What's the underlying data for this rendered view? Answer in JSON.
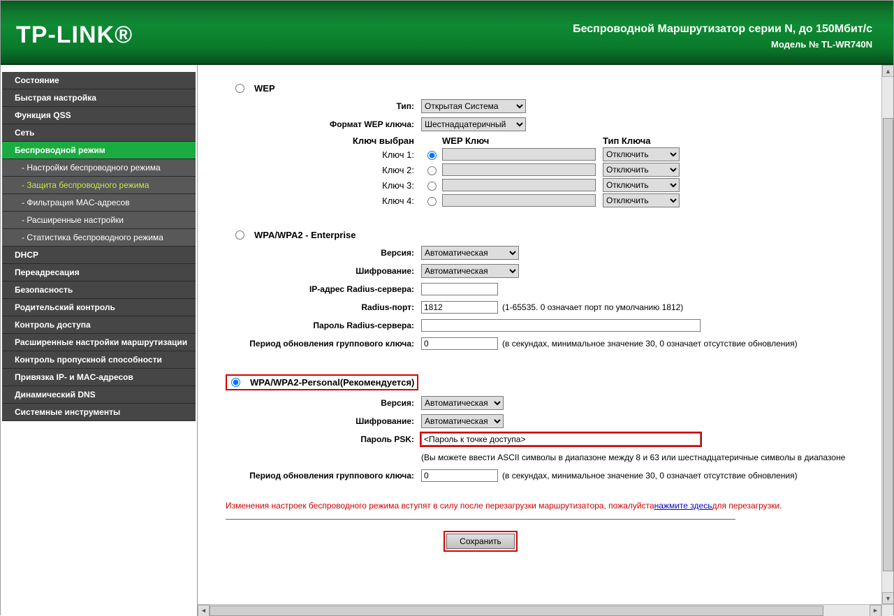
{
  "logo": "TP-LINK®",
  "header": {
    "title": "Беспроводной Маршрутизатор серии N, до 150Мбит/с",
    "model": "Модель № TL-WR740N"
  },
  "sidebar": [
    {
      "label": "Состояние",
      "sub": false
    },
    {
      "label": "Быстрая настройка",
      "sub": false
    },
    {
      "label": "Функция QSS",
      "sub": false
    },
    {
      "label": "Сеть",
      "sub": false
    },
    {
      "label": "Беспроводной режим",
      "sub": false,
      "active": true
    },
    {
      "label": "- Настройки беспроводного режима",
      "sub": true
    },
    {
      "label": "- Защита беспроводного режима",
      "sub": true,
      "current": true
    },
    {
      "label": "- Фильтрация MAC-адресов",
      "sub": true
    },
    {
      "label": "- Расширенные настройки",
      "sub": true
    },
    {
      "label": "- Статистика беспроводного режима",
      "sub": true
    },
    {
      "label": "DHCP",
      "sub": false
    },
    {
      "label": "Переадресация",
      "sub": false
    },
    {
      "label": "Безопасность",
      "sub": false
    },
    {
      "label": "Родительский контроль",
      "sub": false
    },
    {
      "label": "Контроль доступа",
      "sub": false
    },
    {
      "label": "Расширенные настройки маршрутизации",
      "sub": false
    },
    {
      "label": "Контроль пропускной способности",
      "sub": false
    },
    {
      "label": "Привязка IP- и MAC-адресов",
      "sub": false
    },
    {
      "label": "Динамический DNS",
      "sub": false
    },
    {
      "label": "Системные инструменты",
      "sub": false
    }
  ],
  "wep": {
    "title": "WEP",
    "type_label": "Тип:",
    "type_value": "Открытая Система",
    "format_label": "Формат WEP ключа:",
    "format_value": "Шестнадцатеричный",
    "selected_label": "Ключ выбран",
    "wepkey_header": "WEP Ключ",
    "keytype_header": "Тип Ключа",
    "keys": [
      {
        "label": "Ключ 1:",
        "type_value": "Отключить"
      },
      {
        "label": "Ключ 2:",
        "type_value": "Отключить"
      },
      {
        "label": "Ключ 3:",
        "type_value": "Отключить"
      },
      {
        "label": "Ключ 4:",
        "type_value": "Отключить"
      }
    ]
  },
  "ent": {
    "title": "WPA/WPA2 - Enterprise",
    "version_label": "Версия:",
    "version_value": "Автоматическая",
    "enc_label": "Шифрование:",
    "enc_value": "Автоматическая",
    "radius_ip_label": "IP-адрес Radius-сервера:",
    "radius_ip_value": "",
    "radius_port_label": "Radius-порт:",
    "radius_port_value": "1812",
    "radius_port_hint": "(1-65535. 0 означает порт по умолчанию 1812)",
    "radius_pw_label": "Пароль Radius-сервера:",
    "radius_pw_value": "",
    "gk_label": "Период обновления группового ключа:",
    "gk_value": "0",
    "gk_hint": "(в секундах, минимальное значение 30, 0 означает отсутствие обновления)"
  },
  "psk": {
    "title": "WPA/WPA2-Personal(Рекомендуется)",
    "version_label": "Версия:",
    "version_value": "Автоматическая",
    "enc_label": "Шифрование:",
    "enc_value": "Автоматическая",
    "pw_label": "Пароль PSK:",
    "pw_value": "<Пароль к точке доступа>",
    "pw_hint": "(Вы можете ввести ASCII символы в диапазоне между 8 и 63 или шестнадцатеричные символы в диапазоне",
    "gk_label": "Период обновления группового ключа:",
    "gk_value": "0",
    "gk_hint": "(в секундах, минимальное значение 30, 0 означает отсутствие обновления)"
  },
  "warning": {
    "text1": "Изменения настроек беспроводного режима вступят в силу после перезагрузки маршрутизатора, пожалуйста",
    "link": "нажмите здесь",
    "text2": "для перезагрузки."
  },
  "save": "Сохранить"
}
